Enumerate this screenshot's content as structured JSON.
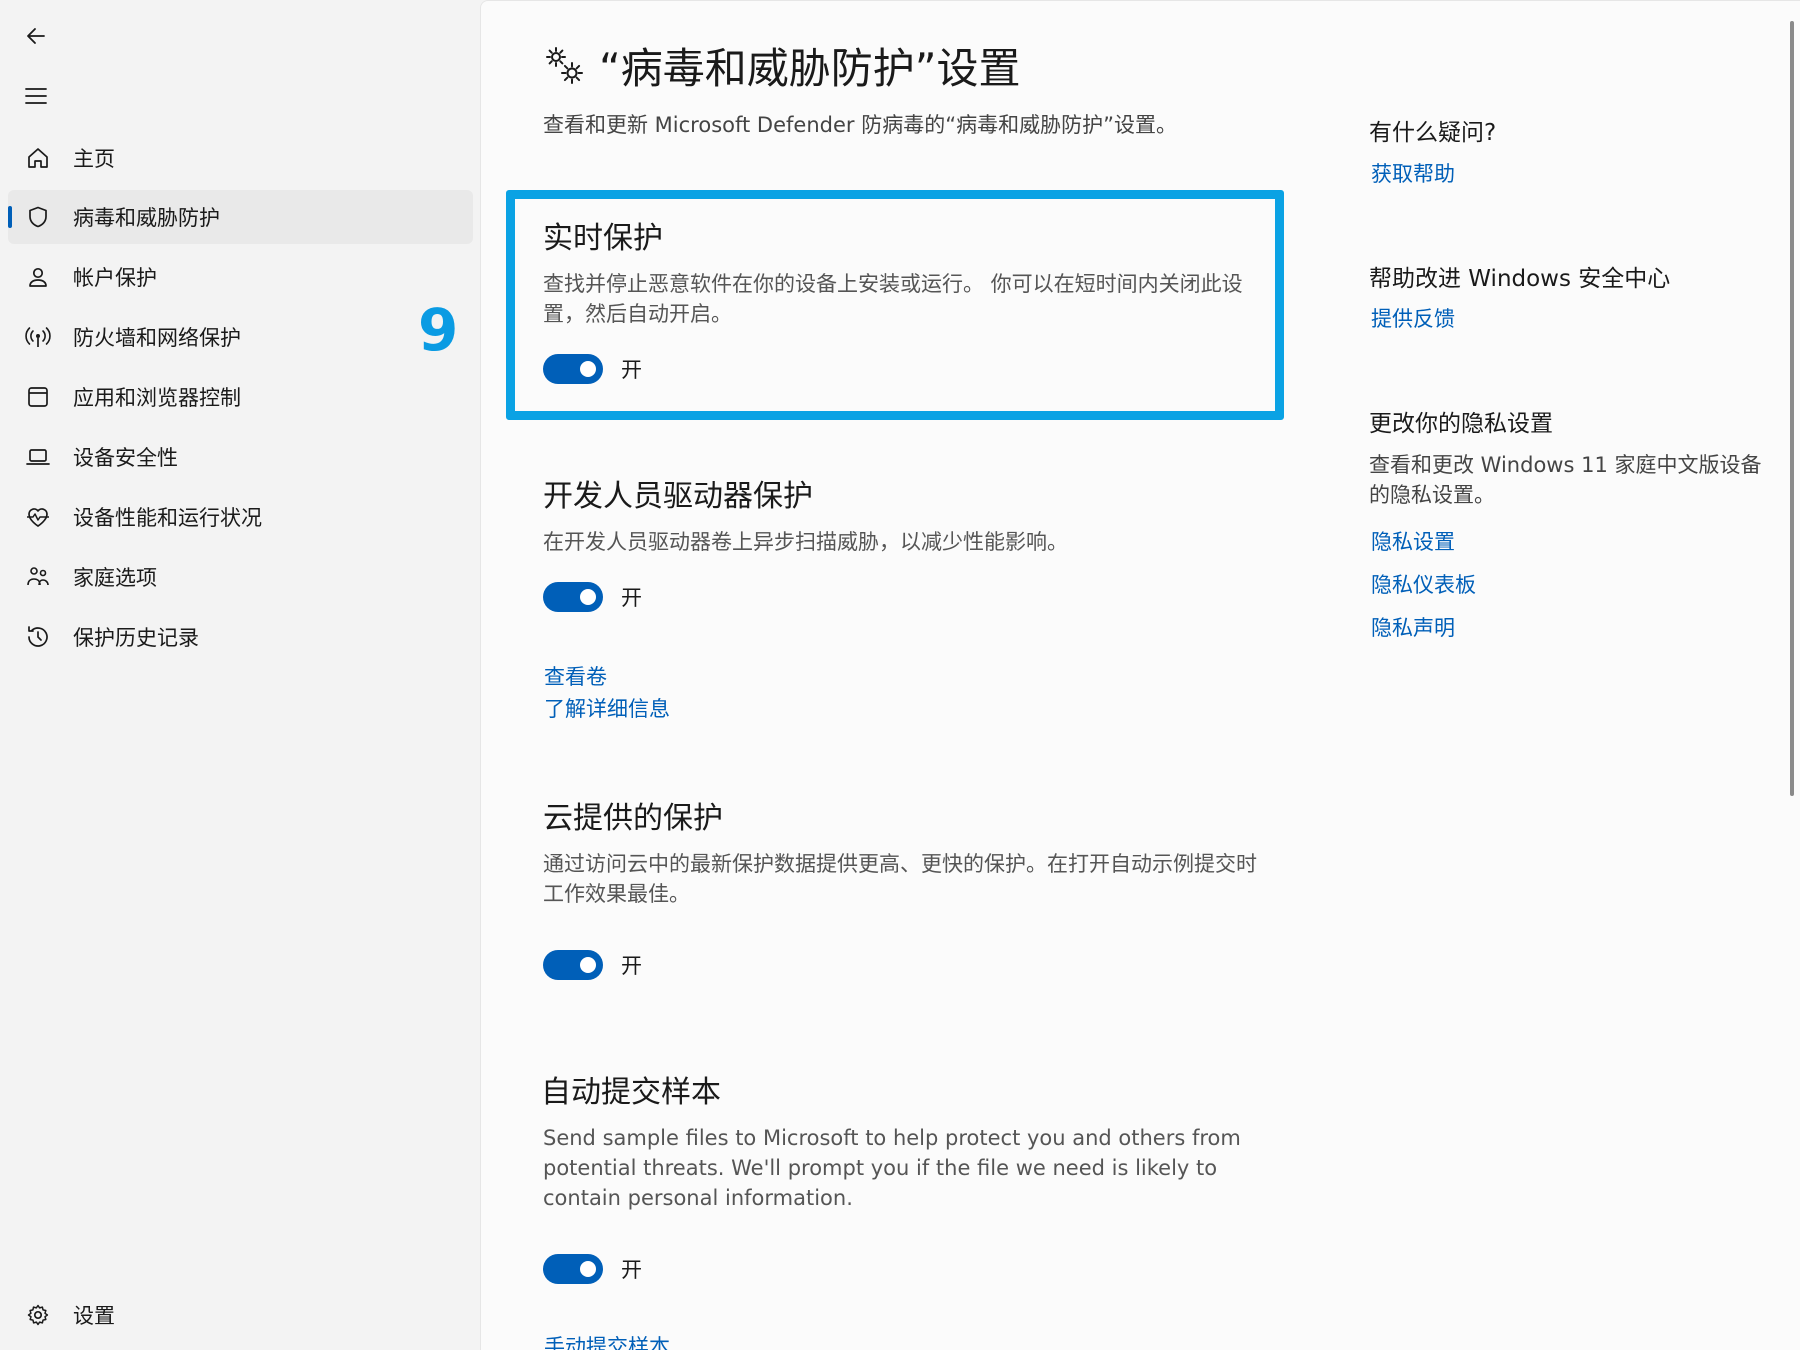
{
  "sidebar": {
    "back_icon": "back-arrow-icon",
    "menu_icon": "hamburger-icon",
    "items": [
      {
        "label": "主页",
        "icon": "home-icon"
      },
      {
        "label": "病毒和威胁防护",
        "icon": "shield-icon",
        "active": true
      },
      {
        "label": "帐户保护",
        "icon": "person-icon"
      },
      {
        "label": "防火墙和网络保护",
        "icon": "antenna-icon"
      },
      {
        "label": "应用和浏览器控制",
        "icon": "app-window-icon"
      },
      {
        "label": "设备安全性",
        "icon": "laptop-icon"
      },
      {
        "label": "设备性能和运行状况",
        "icon": "heart-pulse-icon"
      },
      {
        "label": "家庭选项",
        "icon": "family-icon"
      },
      {
        "label": "保护历史记录",
        "icon": "history-icon"
      }
    ],
    "settings_label": "设置"
  },
  "annotation": {
    "step_number": "9"
  },
  "header": {
    "title": "“病毒和威胁防护”设置",
    "subtitle": "查看和更新 Microsoft Defender 防病毒的“病毒和威胁防护”设置。"
  },
  "sections": {
    "realtime": {
      "title": "实时保护",
      "desc": "查找并停止恶意软件在你的设备上安装或运行。 你可以在短时间内关闭此设置，然后自动开启。",
      "toggle": "开"
    },
    "devdrive": {
      "title": "开发人员驱动器保护",
      "desc": "在开发人员驱动器卷上异步扫描威胁，以减少性能影响。",
      "toggle": "开",
      "link1": "查看卷",
      "link2": "了解详细信息"
    },
    "cloud": {
      "title": "云提供的保护",
      "desc": "通过访问云中的最新保护数据提供更高、更快的保护。在打开自动示例提交时工作效果最佳。",
      "toggle": "开"
    },
    "sample": {
      "title": "自动提交样本",
      "desc": "Send sample files to Microsoft to help protect you and others from potential threats. We'll prompt you if the file we need is likely to contain personal information.",
      "toggle": "开",
      "link": "手动提交样本"
    }
  },
  "right_column": {
    "question_title": "有什么疑问?",
    "get_help": "获取帮助",
    "improve_title": "帮助改进 Windows 安全中心",
    "feedback": "提供反馈",
    "privacy_title": "更改你的隐私设置",
    "privacy_text": "查看和更改 Windows 11 家庭中文版设备的隐私设置。",
    "privacy_settings": "隐私设置",
    "privacy_dashboard": "隐私仪表板",
    "privacy_statement": "隐私声明"
  },
  "colors": {
    "accent": "#005fb8",
    "highlight": "#0aa2e4"
  }
}
